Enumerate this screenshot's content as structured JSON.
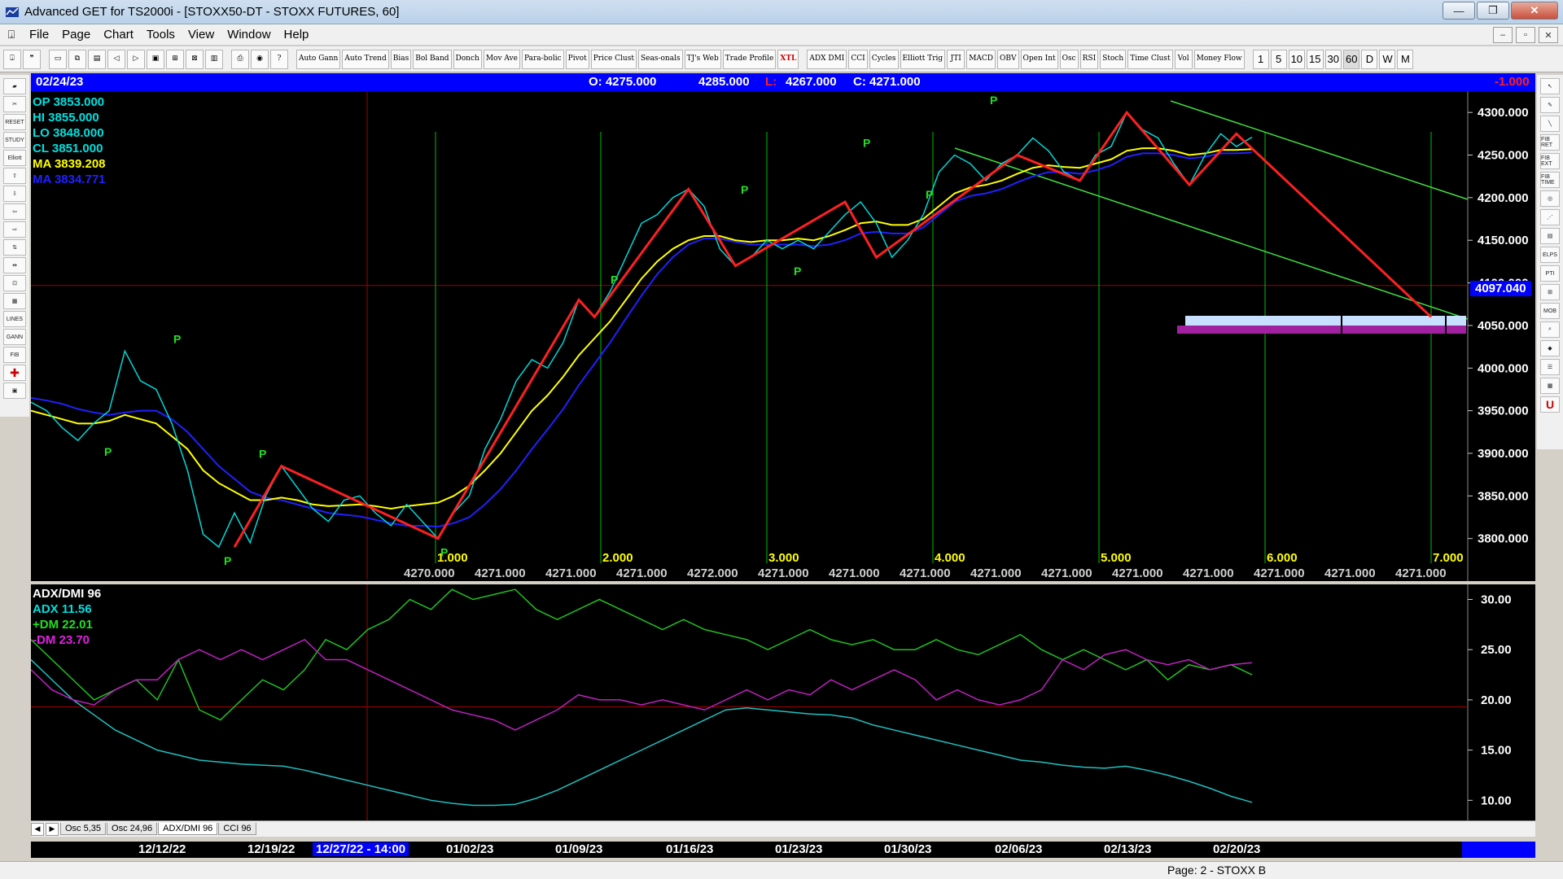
{
  "window": {
    "title": "Advanced GET for TS2000i - [STOXX50-DT - STOXX FUTURES, 60]"
  },
  "menu": [
    "File",
    "Page",
    "Chart",
    "Tools",
    "View",
    "Window",
    "Help"
  ],
  "toolbar": {
    "studies": [
      "Auto Gann",
      "Auto Trend",
      "Bias",
      "Bol Band",
      "Donch",
      "Mov Ave",
      "Para-bolic",
      "Pivot",
      "Price Clust",
      "Seas-onals",
      "TJ's Web",
      "Trade Profile",
      "XTL",
      "ADX DMI",
      "CCI",
      "Cycles",
      "Elliott Trig",
      "JTI",
      "MACD",
      "OBV",
      "Open Int",
      "Osc",
      "RSI",
      "Stoch",
      "Time Clust",
      "Vol",
      "Money Flow"
    ],
    "intervals": [
      "1",
      "5",
      "10",
      "15",
      "30",
      "60",
      "D",
      "W",
      "M"
    ],
    "active_interval": "60"
  },
  "header": {
    "date": "02/24/23",
    "open": "O: 4275.000",
    "high": "4285.000",
    "low_label": "L:",
    "low": "4267.000",
    "close": "C: 4271.000",
    "change": "-1.000"
  },
  "readout": {
    "op": "OP  3853.000",
    "hi": "HI   3855.000",
    "lo": "LO  3848.000",
    "cl": "CL  3851.000",
    "ma1": "MA  3839.208",
    "ma2": "MA  3834.771"
  },
  "price_tag": "4097.040",
  "cycle_labels": [
    "1.000",
    "2.000",
    "3.000",
    "4.000",
    "5.000",
    "6.000",
    "7.000"
  ],
  "projection_values": [
    "4270.000",
    "4271.000",
    "4271.000",
    "4271.000",
    "4272.000",
    "4271.000",
    "4271.000",
    "4271.000",
    "4271.000",
    "4271.000",
    "4271.000",
    "4271.000",
    "4271.000",
    "4271.000",
    "4271.000"
  ],
  "pivot_label": "P",
  "osc_readout": {
    "title": "ADX/DMI 96",
    "adx": "ADX 11.56",
    "pdm": "+DM 22.01",
    "mdm": "-DM 23.70"
  },
  "tabs": [
    "Osc 5,35",
    "Osc 24,96",
    "ADX/DMI 96",
    "CCI 96"
  ],
  "active_tab": "ADX/DMI 96",
  "dates": [
    "12/12/22",
    "12/19/22",
    "12/27/22 - 14:00",
    "01/02/23",
    "01/09/23",
    "01/16/23",
    "01/23/23",
    "01/30/23",
    "02/06/23",
    "02/13/23",
    "02/20/23"
  ],
  "status": "Page: 2 - STOXX B",
  "colors": {
    "background": "#000000",
    "header": "#0000ff",
    "ma_fast": "#ffff00",
    "ma_slow": "#2020ff",
    "zigzag": "#ff2020",
    "cycle": "#00c000",
    "adx": "#20c0c0",
    "pdm": "#20c020",
    "mdm": "#c020c0"
  },
  "chart_data": [
    {
      "type": "line",
      "title": "STOXX50-DT - STOXX FUTURES, 60",
      "ylim": [
        3750,
        4325
      ],
      "y_ticks": [
        "4300.000",
        "4250.000",
        "4200.000",
        "4150.000",
        "4100.000",
        "4050.000",
        "4000.000",
        "3950.000",
        "3900.000",
        "3850.000",
        "3800.000"
      ],
      "x_dates": [
        "12/12/22",
        "12/19/22",
        "12/27/22",
        "01/02/23",
        "01/09/23",
        "01/16/23",
        "01/23/23",
        "01/30/23",
        "02/06/23",
        "02/13/23",
        "02/20/23"
      ],
      "series": [
        {
          "values": [
            3960,
            3950,
            3930,
            3915,
            3935,
            3950,
            4020,
            3985,
            3975,
            3935,
            3880,
            3805,
            3790,
            3830,
            3795,
            3850,
            3885,
            3860,
            3835,
            3820,
            3845,
            3850,
            3830,
            3815,
            3840,
            3820,
            3800,
            3830,
            3850,
            3905,
            3940,
            3985,
            4010,
            4000,
            4030,
            4080,
            4060,
            4090,
            4130,
            4170,
            4180,
            4200,
            4210,
            4190,
            4140,
            4120,
            4130,
            4150,
            4140,
            4150,
            4140,
            4160,
            4180,
            4195,
            4170,
            4130,
            4150,
            4180,
            4230,
            4250,
            4240,
            4220,
            4240,
            4250,
            4270,
            4255,
            4230,
            4220,
            4250,
            4260,
            4300,
            4280,
            4270,
            4240,
            4215,
            4250,
            4275,
            4260,
            4271
          ]
        },
        {
          "values": [
            3950,
            3945,
            3940,
            3935,
            3935,
            3938,
            3945,
            3940,
            3935,
            3920,
            3905,
            3880,
            3865,
            3855,
            3845,
            3845,
            3848,
            3845,
            3840,
            3838,
            3839,
            3840,
            3838,
            3835,
            3838,
            3840,
            3842,
            3850,
            3862,
            3880,
            3900,
            3925,
            3950,
            3968,
            3990,
            4015,
            4035,
            4055,
            4080,
            4105,
            4125,
            4140,
            4150,
            4155,
            4155,
            4150,
            4148,
            4150,
            4150,
            4152,
            4150,
            4155,
            4162,
            4170,
            4172,
            4168,
            4168,
            4175,
            4190,
            4205,
            4212,
            4215,
            4220,
            4228,
            4235,
            4238,
            4236,
            4235,
            4240,
            4245,
            4255,
            4258,
            4258,
            4255,
            4250,
            4252,
            4256,
            4256,
            4257
          ]
        },
        {
          "values": [
            3965,
            3962,
            3958,
            3952,
            3948,
            3945,
            3948,
            3950,
            3950,
            3940,
            3925,
            3905,
            3885,
            3870,
            3855,
            3848,
            3845,
            3840,
            3835,
            3830,
            3828,
            3826,
            3822,
            3818,
            3815,
            3815,
            3814,
            3818,
            3825,
            3840,
            3858,
            3880,
            3905,
            3928,
            3952,
            3980,
            4005,
            4030,
            4058,
            4085,
            4110,
            4130,
            4145,
            4152,
            4152,
            4148,
            4145,
            4145,
            4145,
            4145,
            4143,
            4145,
            4150,
            4158,
            4160,
            4158,
            4158,
            4165,
            4180,
            4195,
            4202,
            4205,
            4210,
            4218,
            4225,
            4230,
            4230,
            4228,
            4232,
            4238,
            4248,
            4252,
            4252,
            4250,
            4246,
            4248,
            4252,
            4252,
            4253
          ]
        }
      ]
    },
    {
      "type": "line",
      "title": "ADX/DMI 96",
      "ylim": [
        8,
        31.5
      ],
      "y_ticks": [
        "30.00",
        "25.00",
        "20.00",
        "15.00",
        "10.00"
      ],
      "series": [
        {
          "name": "ADX",
          "values": [
            24,
            22,
            20,
            18.5,
            17,
            16,
            15,
            14.5,
            14,
            13.8,
            13.6,
            13.5,
            13.4,
            13,
            12.5,
            12,
            11.5,
            11,
            10.5,
            10,
            9.7,
            9.5,
            9.5,
            9.6,
            10.2,
            11,
            12,
            13,
            14,
            15,
            16,
            17,
            18,
            19,
            19.2,
            19,
            18.8,
            18.6,
            18.5,
            18.2,
            17.5,
            17,
            16.5,
            16,
            15.5,
            15,
            14.5,
            14,
            13.8,
            13.5,
            13.3,
            13.2,
            13.4,
            13,
            12.5,
            11.9,
            11.2,
            10.4,
            9.8
          ]
        },
        {
          "name": "+DM",
          "values": [
            26,
            24,
            22,
            20,
            21,
            22,
            20,
            24,
            19,
            18,
            20,
            22,
            21,
            23,
            26,
            25,
            27,
            28,
            30,
            29,
            31,
            30,
            30.5,
            31,
            29,
            28,
            29,
            30,
            29,
            28,
            27,
            28,
            27,
            26.5,
            26,
            25,
            26,
            27,
            26,
            25.5,
            26,
            25,
            25,
            26,
            25,
            24.5,
            25.5,
            26.5,
            25,
            24,
            25,
            24,
            23,
            24,
            22,
            23.5,
            23,
            23.5,
            22.5
          ]
        },
        {
          "name": "-DM",
          "values": [
            23,
            21,
            20,
            19.5,
            21,
            22,
            22,
            24,
            25,
            24,
            25,
            24,
            25,
            26,
            24,
            24,
            23,
            22,
            21,
            20,
            19,
            18.5,
            18,
            17,
            18,
            19,
            20.5,
            20,
            20,
            19.5,
            20,
            19.5,
            19,
            20,
            21,
            20,
            21,
            20.5,
            22,
            21,
            22,
            23,
            22,
            20,
            21,
            20,
            19.5,
            20,
            21,
            24,
            23,
            24.5,
            25,
            24,
            23.5,
            24,
            23,
            23.5,
            23.7
          ]
        }
      ]
    }
  ]
}
